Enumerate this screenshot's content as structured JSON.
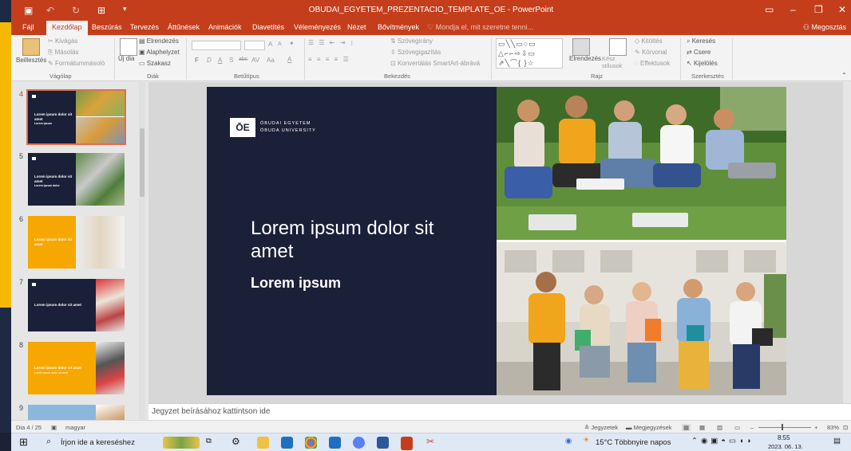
{
  "titlebar": {
    "title": "OBUDAI_EGYETEM_PREZENTACIO_TEMPLATE_OE - PowerPoint"
  },
  "tabs": [
    {
      "label": "Fájl"
    },
    {
      "label": "Kezdőlap"
    },
    {
      "label": "Beszúrás"
    },
    {
      "label": "Tervezés"
    },
    {
      "label": "Áttűnések"
    },
    {
      "label": "Animációk"
    },
    {
      "label": "Diavetítés"
    },
    {
      "label": "Véleményezés"
    },
    {
      "label": "Nézet"
    },
    {
      "label": "Bővítmények"
    }
  ],
  "tellme": "Mondja el, mit szeretne tenni...",
  "share_label": "Megosztás",
  "ribbon": {
    "clipboard": {
      "paste": "Beillesztés",
      "cut": "Kivágás",
      "copy": "Másolás",
      "format_painter": "Formátummásoló",
      "label": "Vágólap"
    },
    "slides": {
      "new_slide": "Új dia",
      "layout": "Elrendezés",
      "reset": "Alaphelyzet",
      "section": "Szakasz",
      "label": "Diák"
    },
    "font": {
      "bold": "F",
      "italic": "D",
      "underline": "A",
      "shadow": "S",
      "strike": "abc",
      "spacing": "AV",
      "case": "Aa",
      "color": "A",
      "grow": "A",
      "shrink": "A",
      "label": "Betűtípus"
    },
    "paragraph": {
      "direction": "Szövegirány",
      "align": "Szövegigazítás",
      "smartart": "Konvertálás SmartArt-ábrává",
      "label": "Bekezdés"
    },
    "drawing": {
      "arrange": "Elrendezés",
      "quick_styles": "Kész stílusok",
      "fill": "Kitöltés",
      "outline": "Körvonal",
      "effects": "Effektusok",
      "label": "Rajz"
    },
    "editing": {
      "find": "Keresés",
      "replace": "Csere",
      "select": "Kijelölés",
      "label": "Szerkesztés"
    }
  },
  "thumbnails": [
    {
      "num": "4",
      "title": "Lorem ipsum dolor sit amet",
      "sub": "Lorem ipsum"
    },
    {
      "num": "5",
      "title": "Lorem ipsum dolor sit amet",
      "sub": "Lorem ipsum dolor"
    },
    {
      "num": "6",
      "title": "Lorem ipsum dolor sit amet",
      "sub": ""
    },
    {
      "num": "7",
      "title": "Lorem ipsum dolor sit amet",
      "sub": ""
    },
    {
      "num": "8",
      "title": "Lorem ipsum dolor sit amet",
      "sub": "Lorem ipsum dolor sit amet"
    },
    {
      "num": "9",
      "title": "",
      "sub": ""
    }
  ],
  "slide": {
    "logo_mark": "ŌE",
    "logo_line1": "ÓBUDAI EGYETEM",
    "logo_line2": "ÓBUDA UNIVERSITY",
    "title": "Lorem ipsum dolor sit amet",
    "subtitle": "Lorem ipsum"
  },
  "notes_placeholder": "Jegyzet beírásához kattintson ide",
  "status": {
    "slide_counter": "Dia 4 / 25",
    "language": "magyar",
    "notes": "Jegyzetek",
    "comments": "Megjegyzések",
    "zoom": "83%"
  },
  "taskbar": {
    "search_placeholder": "Írjon ide a kereséshez",
    "weather": "15°C  Többnyire napos",
    "time": "8:55",
    "date": "2023. 06. 13."
  }
}
